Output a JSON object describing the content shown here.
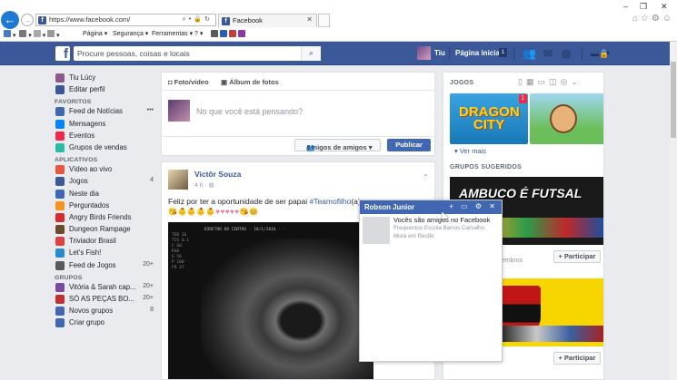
{
  "browser": {
    "url": "https://www.facebook.com/",
    "tab_title": "Facebook",
    "tab_close": "✕",
    "win_min": "–",
    "win_max": "❐",
    "win_close": "✕",
    "commands": [
      "Página ▾",
      "Segurança ▾",
      "Ferramentas ▾",
      "? ▾"
    ]
  },
  "fb_header": {
    "logo": "f",
    "search_placeholder": "Procure pessoas, coisas e locais",
    "user_name": "Tiu",
    "home_label": "Página inicial",
    "home_badge": "1"
  },
  "sidebar": {
    "profile": [
      {
        "label": "Tiu Lúcy",
        "color": "#8a5a8a",
        "icon": "avatar"
      },
      {
        "label": "Editar perfil",
        "color": "#3b5998",
        "icon": "edit-icon"
      }
    ],
    "favoritos_title": "FAVORITOS",
    "favoritos": [
      {
        "label": "Feed de Notícias",
        "count": "•••",
        "color": "#4267b2",
        "icon": "news-feed-icon"
      },
      {
        "label": "Mensagens",
        "count": "",
        "color": "#0084ff",
        "icon": "messages-icon"
      },
      {
        "label": "Eventos",
        "count": "",
        "color": "#f02849",
        "icon": "events-icon"
      },
      {
        "label": "Grupos de vendas",
        "count": "",
        "color": "#2abba7",
        "icon": "sale-groups-icon"
      }
    ],
    "aplicativos_title": "APLICATIVOS",
    "aplicativos": [
      {
        "label": "Vídeo ao vivo",
        "count": "",
        "color": "#e9573f",
        "icon": "live-video-icon"
      },
      {
        "label": "Jogos",
        "count": "4",
        "color": "#3b5998",
        "icon": "games-icon"
      },
      {
        "label": "Neste dia",
        "count": "",
        "color": "#4267b2",
        "icon": "on-this-day-icon"
      },
      {
        "label": "Perguntados",
        "count": "",
        "color": "#f7931e",
        "icon": "perguntados-icon"
      },
      {
        "label": "Angry Birds Friends",
        "count": "",
        "color": "#d92b2b",
        "icon": "angry-birds-icon"
      },
      {
        "label": "Dungeon Rampage",
        "count": "",
        "color": "#6b4a2a",
        "icon": "dungeon-rampage-icon"
      },
      {
        "label": "Triviador Brasil",
        "count": "",
        "color": "#e04040",
        "icon": "triviador-icon"
      },
      {
        "label": "Let's Fish!",
        "count": "",
        "color": "#2a8ad0",
        "icon": "lets-fish-icon"
      },
      {
        "label": "Feed de Jogos",
        "count": "20+",
        "color": "#5a5a5a",
        "icon": "games-feed-icon"
      }
    ],
    "grupos_title": "GRUPOS",
    "grupos": [
      {
        "label": "Vitória & Sarah cap...",
        "count": "20+",
        "color": "#7a4aa0",
        "icon": "group-icon"
      },
      {
        "label": "SÓ AS PEÇAS BO...",
        "count": "20+",
        "color": "#c03030",
        "icon": "group-icon"
      },
      {
        "label": "Novos grupos",
        "count": "8",
        "color": "#4267b2",
        "icon": "new-groups-icon"
      },
      {
        "label": "Criar grupo",
        "count": "",
        "color": "#4267b2",
        "icon": "create-group-icon"
      }
    ]
  },
  "composer": {
    "tab_photo": "Foto/vídeo",
    "tab_album": "Álbum de fotos",
    "placeholder": "No que você está pensando?",
    "audience": "Amigos de amigos ▾",
    "publish": "Publicar"
  },
  "post": {
    "author": "Victôr Souza",
    "time": "4 h · ◍",
    "text_prefix": "Feliz por ter a oportunidade de ser papai ",
    "hashtag": "#Teamofilho",
    "text_suffix": "(a)",
    "emojis": "😘👶👶👶👶♥♥♥♥♥😘😊",
    "chevron": "⌄",
    "ultra_header": "DIRETOR DO CENTRO · 18/1/2016 ·  ·",
    "ultra_side": "TEB 16\nTIS 0.1\nC 60\nR40\nG 56\nP 100\nFR 47"
  },
  "rightcol": {
    "games_title": "JOGOS",
    "game1_title": "DRAGON CITY",
    "game1_badge": "1",
    "see_more": "▾  Ver mais",
    "groups_title": "GRUPOS SUGERIDOS",
    "group1_text": "AMBUCO É FUTSAL",
    "group1_members": "membros",
    "join_label": "+ Participar"
  },
  "chat": {
    "name": "Robson Junior",
    "icons": "+ ▭ ⚙ ✕",
    "line1": "Vocês são amigos no Facebook",
    "line2": "Frequentou Escola Barros Carvalho",
    "line3": "Mora em Recife"
  }
}
